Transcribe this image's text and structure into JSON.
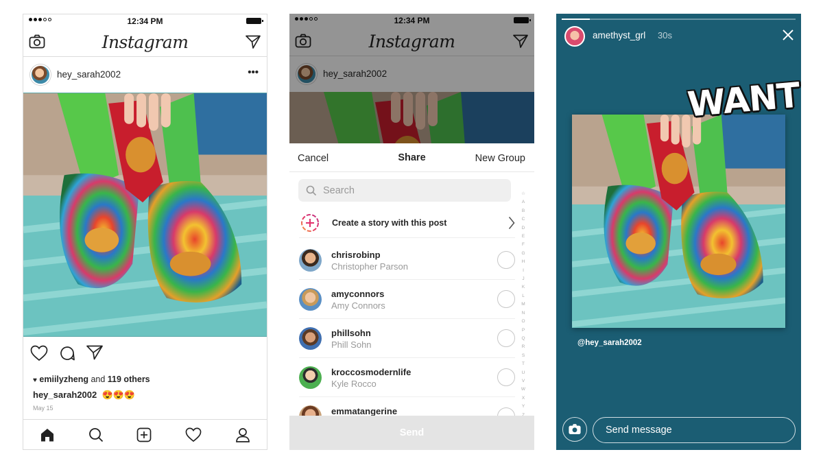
{
  "feed": {
    "status": {
      "time": "12:34 PM"
    },
    "logo": "Instagram",
    "post": {
      "username": "hey_sarah2002",
      "more_label": "•••",
      "liked_by": "emiilyzheng",
      "likes_text": "and",
      "likes_count": "119 others",
      "caption_user": "hey_sarah2002",
      "caption_emoji": "😍😍😍",
      "date": "May 15"
    },
    "icons": {
      "header": [
        "camera-icon",
        "direct-icon"
      ],
      "actions": [
        "heart-icon",
        "comment-icon",
        "share-icon"
      ],
      "tabbar": [
        "home-icon",
        "search-icon",
        "add-icon",
        "activity-icon",
        "profile-icon"
      ]
    }
  },
  "share": {
    "status": {
      "time": "12:34 PM"
    },
    "logo": "Instagram",
    "username": "hey_sarah2002",
    "header": {
      "cancel": "Cancel",
      "title": "Share",
      "new_group": "New Group"
    },
    "search_placeholder": "Search",
    "story_option": "Create a story with this post",
    "contacts": [
      {
        "username": "chrisrobinp",
        "name": "Christopher Parson"
      },
      {
        "username": "amyconnors",
        "name": "Amy Connors"
      },
      {
        "username": "phillsohn",
        "name": "Phill Sohn"
      },
      {
        "username": "kroccosmodernlife",
        "name": "Kyle Rocco"
      },
      {
        "username": "emmatangerine",
        "name": ""
      }
    ],
    "alphabet": [
      "☆",
      "A",
      "B",
      "C",
      "D",
      "E",
      "F",
      "G",
      "H",
      "I",
      "J",
      "K",
      "L",
      "M",
      "N",
      "O",
      "P",
      "Q",
      "R",
      "S",
      "T",
      "U",
      "V",
      "W",
      "X",
      "Y",
      "Z"
    ],
    "send_label": "Send"
  },
  "story": {
    "progress": 0.12,
    "username": "amethyst_grl",
    "time": "30s",
    "sticker_text": "WANT",
    "mention": "@hey_sarah2002",
    "message_placeholder": "Send message"
  },
  "colors": {
    "story_bg": "#1b5d73",
    "send_disabled": "#e4e4e4",
    "story_ring": "#e1306c"
  }
}
